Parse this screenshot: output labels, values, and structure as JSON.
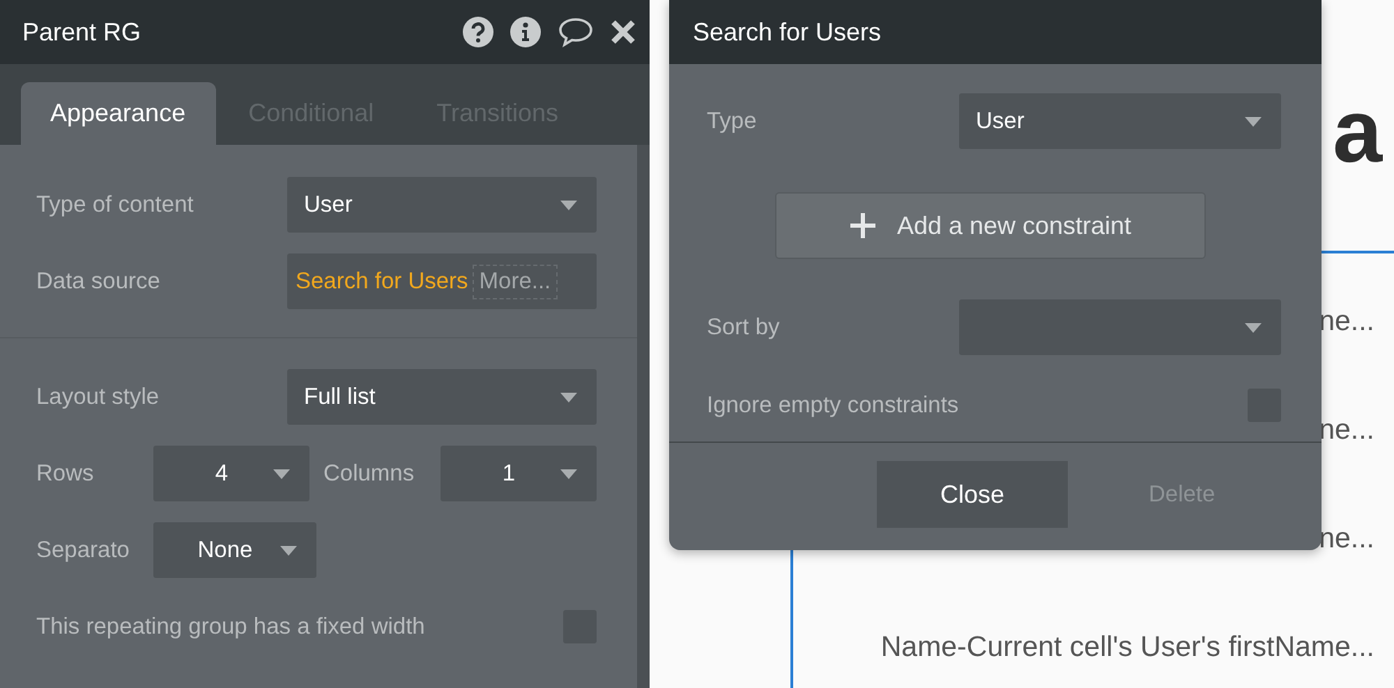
{
  "panel": {
    "title": "Parent RG",
    "tabs": [
      {
        "label": "Appearance",
        "selected": true
      },
      {
        "label": "Conditional",
        "selected": false
      },
      {
        "label": "Transitions",
        "selected": false
      }
    ],
    "sections": [
      [
        {
          "kind": "dropdown",
          "label": "Type of content",
          "value": "User"
        },
        {
          "kind": "source",
          "label": "Data source",
          "value": "Search for Users",
          "more": "More..."
        }
      ],
      [
        {
          "kind": "dropdown",
          "label": "Layout style",
          "value": "Full list"
        },
        {
          "kind": "pair",
          "items": [
            {
              "label": "Rows",
              "value": "4"
            },
            {
              "label": "Columns",
              "value": "1"
            }
          ]
        },
        {
          "kind": "small",
          "label": "Separato",
          "value": "None"
        },
        {
          "kind": "checkbox",
          "label": "This repeating group has a fixed width",
          "checked": false
        }
      ]
    ]
  },
  "canvas": {
    "heading": "a",
    "cells": [
      "ne...",
      "ne...",
      "ne...",
      "Name-Current cell's User's firstName..."
    ]
  },
  "popup": {
    "title": "Search for Users",
    "type": {
      "label": "Type",
      "value": "User"
    },
    "add_button": "Add a new constraint",
    "sort_by": {
      "label": "Sort by"
    },
    "ignore_empty": {
      "label": "Ignore empty constraints",
      "checked": false
    },
    "close_button": "Close",
    "delete_button": {
      "label": "Delete",
      "disabled": true
    }
  }
}
